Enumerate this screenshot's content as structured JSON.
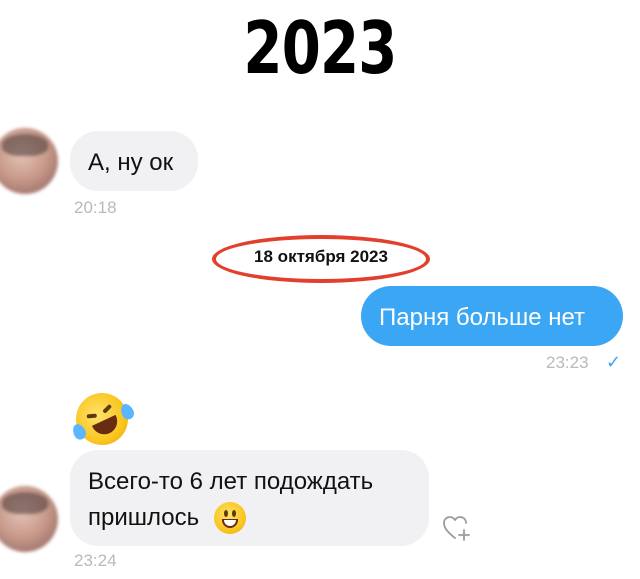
{
  "header": {
    "year": "2023"
  },
  "messages": [
    {
      "text": "А, ну ок",
      "time": "20:18"
    },
    {
      "text": "Парня больше нет",
      "time": "23:23",
      "status_icon": "check-icon"
    },
    {
      "line1": "Всего-то 6 лет подождать",
      "line2": "пришлось",
      "time": "23:24"
    }
  ],
  "date_separator": "18 октября 2023",
  "colors": {
    "outgoing_bubble": "#3aa6f4",
    "incoming_bubble": "#f1f1f3",
    "highlight_circle": "#e2402d"
  },
  "icons": {
    "reaction": "rolling-on-floor-laughing-emoji",
    "inline_emoji": "grinning-face-emoji",
    "react_button": "heart-plus-icon",
    "avatar": "blurred-avatar"
  }
}
